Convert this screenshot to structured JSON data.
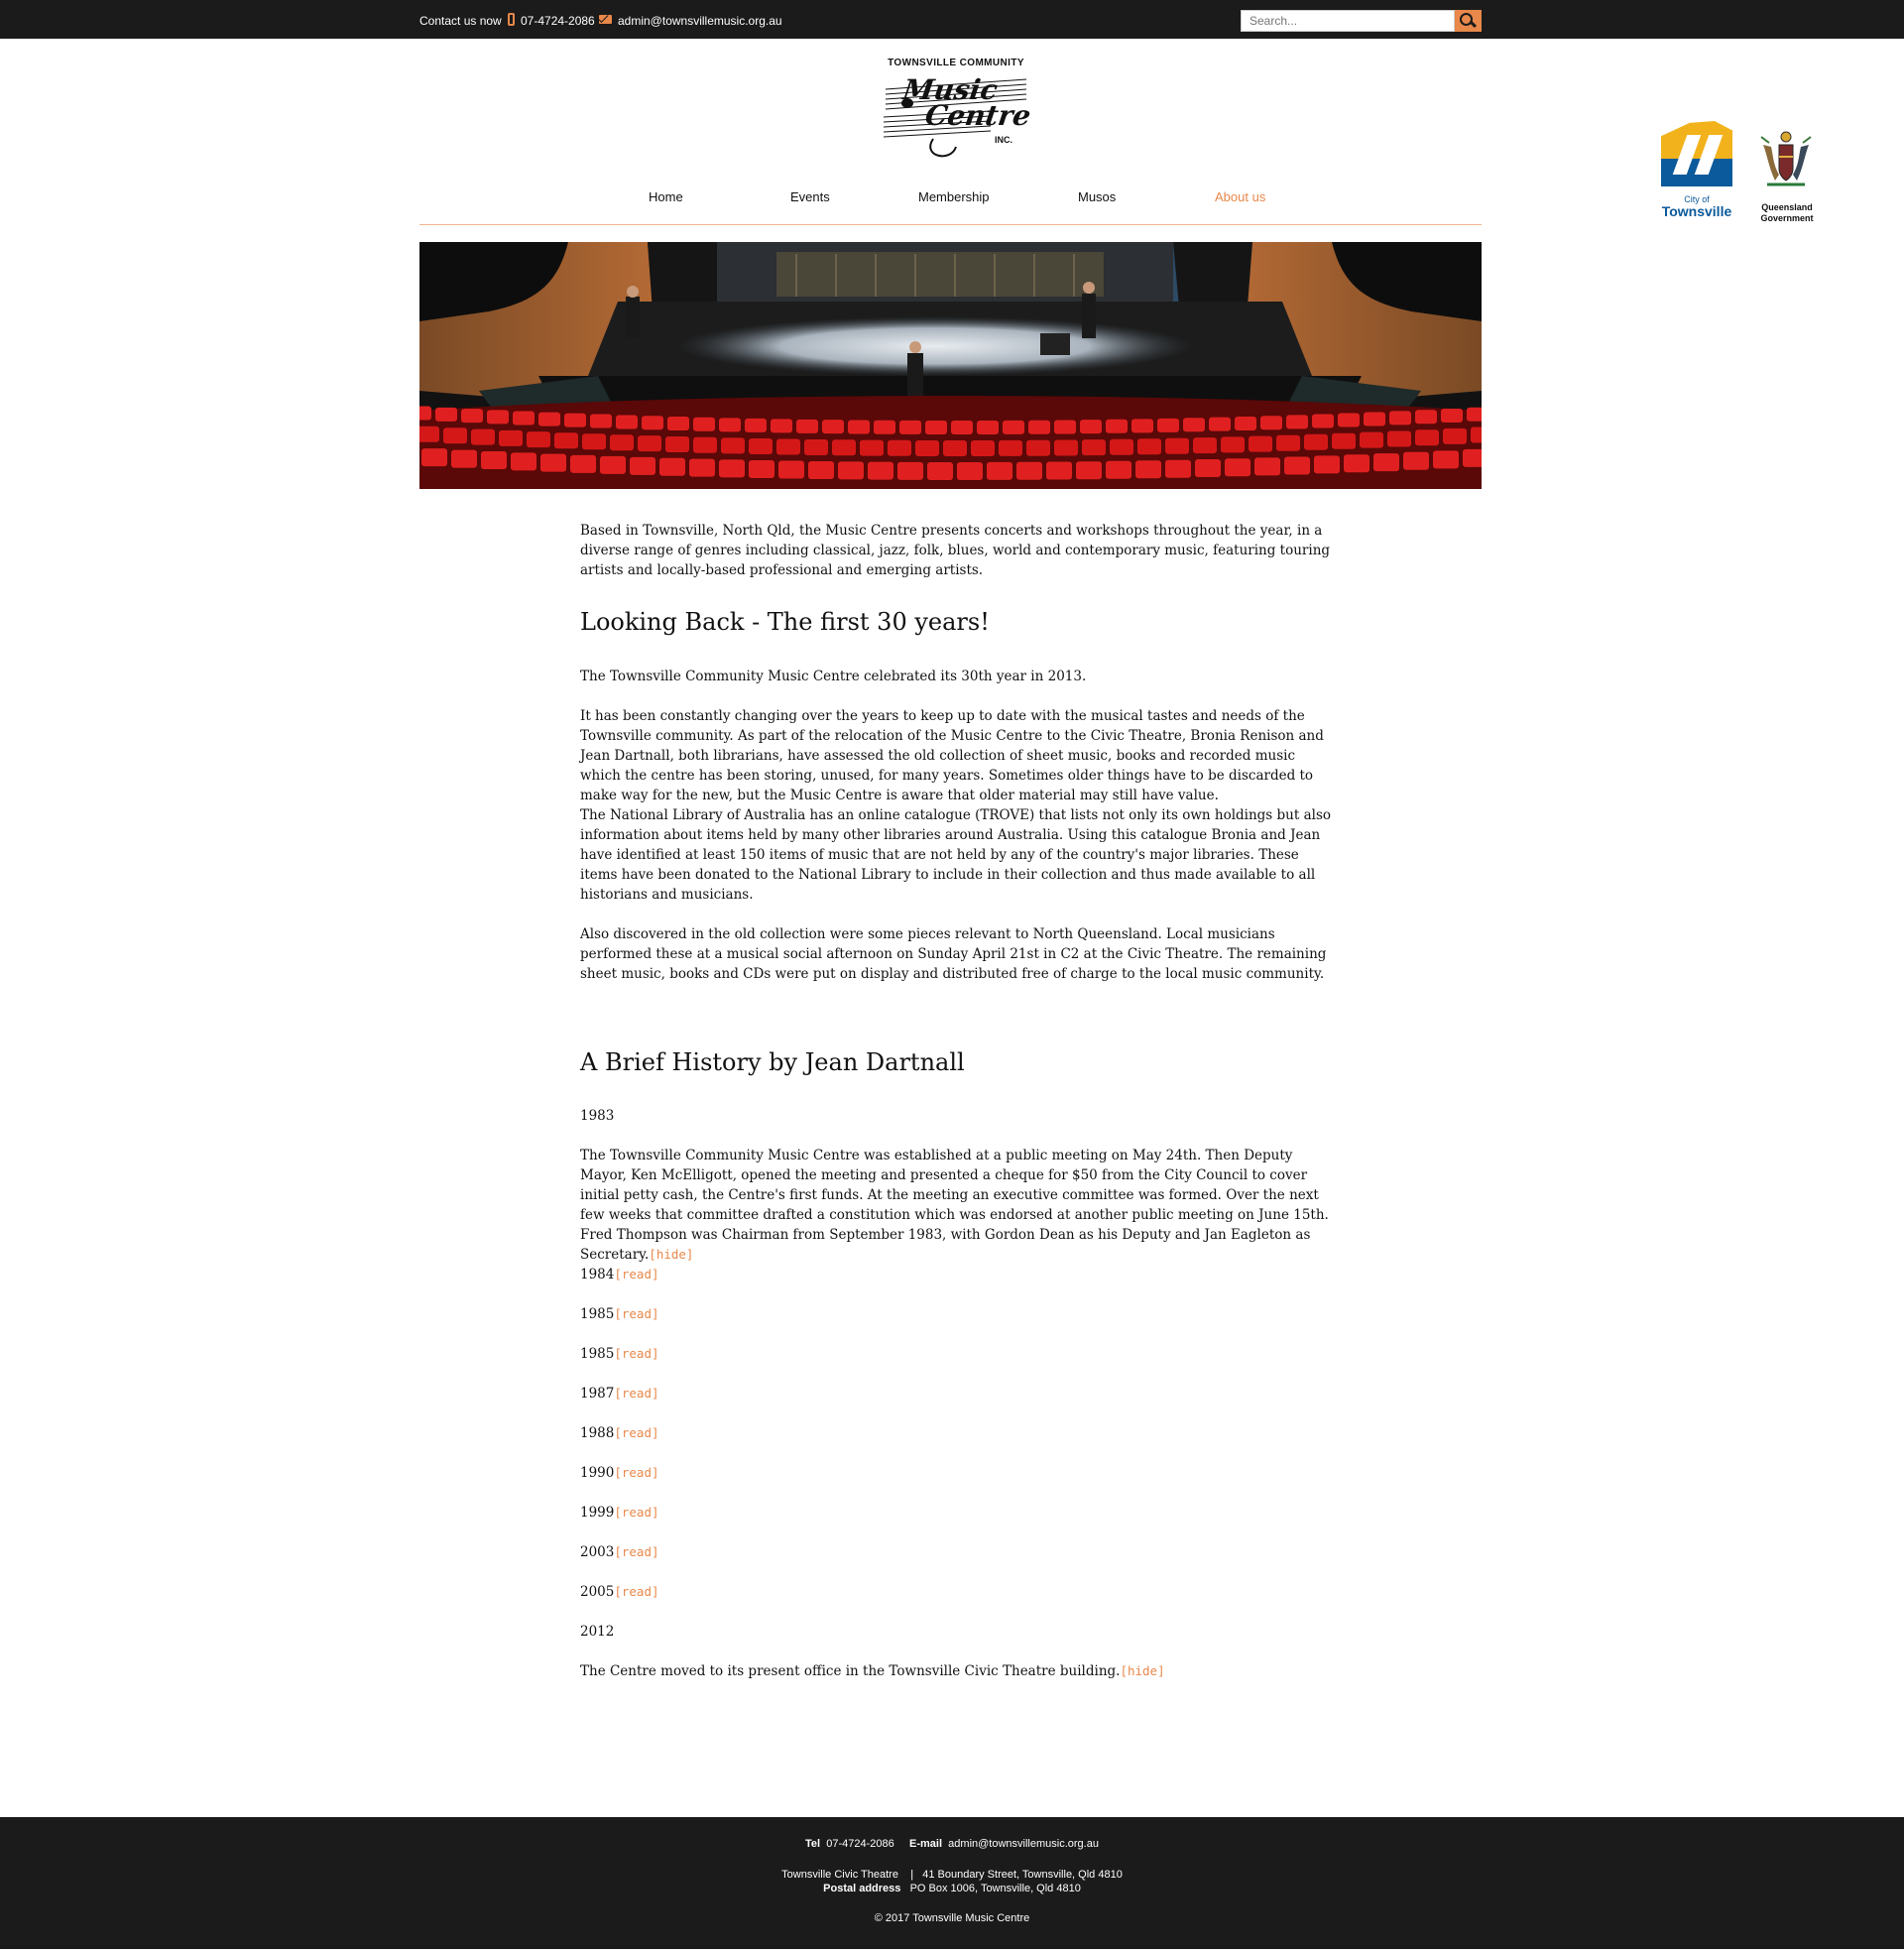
{
  "topbar": {
    "contact_label": "Contact us now",
    "phone": "07-4724-2086",
    "email": "admin@townsvillemusic.org.au",
    "search_placeholder": "Search...",
    "accent_color": "#e8884a"
  },
  "logo": {
    "top_text": "TOWNSVILLE COMMUNITY",
    "script_line1": "Music",
    "script_line2": "Centre",
    "suffix": "INC."
  },
  "sponsors": {
    "townsville": {
      "line1": "City of",
      "line2": "Townsville",
      "colors": [
        "#f2b21c",
        "#0b5a9b"
      ]
    },
    "queensland": {
      "line1": "Queensland",
      "line2": "Government"
    }
  },
  "nav": {
    "items": [
      {
        "label": "Home"
      },
      {
        "label": "Events"
      },
      {
        "label": "Membership"
      },
      {
        "label": "Musos"
      },
      {
        "label": "About us",
        "active": true
      }
    ]
  },
  "content": {
    "intro": "Based in Townsville, North Qld, the Music Centre presents concerts and workshops throughout the year, in a diverse range of genres including classical, jazz, folk, blues, world and contemporary music, featuring touring artists and locally-based professional and emerging artists.",
    "heading1": "Looking Back - The first 30 years!",
    "p1": "The Townsville Community Music Centre celebrated its 30th year in 2013.",
    "p2": "It has been constantly changing over the years to keep up to date with the musical tastes and needs of the Townsville community. As part of the relocation of the Music Centre to the Civic Theatre, Bronia Renison and Jean Dartnall, both librarians, have assessed the old collection of sheet music, books and recorded music which the centre has been storing, unused, for many years. Sometimes older things have to be discarded to make way for the new, but the Music Centre is aware that older material may still have value.",
    "p3": "The National Library of Australia has an online catalogue (TROVE) that lists not only its own holdings but also information about items held by many other libraries around Australia. Using this catalogue Bronia and Jean have identified at least 150 items of music that are not held by any of the country's major libraries. These items have been donated to the National Library to include in their collection and thus made available to all historians and musicians.",
    "p4": "Also discovered in the old collection were some pieces relevant to North Queensland. Local musicians performed these at a musical social afternoon on Sunday April 21st in C2 at the Civic Theatre. The remaining sheet music, books and CDs were put on display and distributed free of charge to the local music community.",
    "heading2": "A Brief History by Jean Dartnall",
    "year_1983": "1983",
    "text_1983": "The Townsville Community Music Centre was established at a public meeting on May 24th. Then Deputy Mayor, Ken McElligott, opened the meeting and presented a cheque for $50 from the City Council to cover initial petty cash, the Centre's first funds. At the meeting an executive committee was formed. Over the next few weeks that committee drafted a constitution which was endorsed at another public meeting on June 15th. Fred Thompson was Chairman from September 1983, with Gordon Dean as his Deputy and Jan Eagleton as Secretary.",
    "hide_label": "[hide]",
    "read_label": "[read]",
    "years": [
      "1984",
      "1985",
      "1985",
      "1987",
      "1988",
      "1990",
      "1999",
      "2003",
      "2005"
    ],
    "year_2012": "2012",
    "text_2012": "The Centre moved to its present office in the Townsville Civic Theatre building."
  },
  "footer": {
    "tel_label": "Tel",
    "tel": "07-4724-2086",
    "email_label": "E-mail",
    "email": "admin@townsvillemusic.org.au",
    "venue": "Townsville Civic Theatre",
    "separator": "|",
    "street": "41 Boundary Street, Townsville, Qld 4810",
    "postal_label": "Postal address",
    "postal": "PO Box 1006, Townsville, Qld 4810",
    "copyright": "© 2017 Townsville Music Centre"
  }
}
